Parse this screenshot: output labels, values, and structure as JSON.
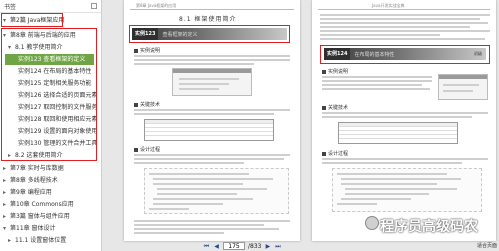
{
  "sidebar": {
    "title": "书签",
    "items": [
      {
        "label": "第2篇 Java框架应用",
        "arrow": "▾"
      },
      {
        "label": "第8章 前端与后端的应用",
        "arrow": "▾"
      },
      {
        "label": "8.1 教学使用简介",
        "arrow": "▾"
      },
      {
        "label": "实例123 查看框架的定义"
      },
      {
        "label": "实例124 在布局的基本特性"
      },
      {
        "label": "实例125 定制相关服务功能"
      },
      {
        "label": "实例126 选择合适的页面元素"
      },
      {
        "label": "实例127 取回控制的文件服务"
      },
      {
        "label": "实例128 取回和使用相应元素"
      },
      {
        "label": "实例129 设置的面向对象使用"
      },
      {
        "label": "实例130 管理的文件合并工具"
      },
      {
        "label": "8.2 这套使用简介",
        "arrow": "▸"
      },
      {
        "label": "第7章 实时与库数据",
        "arrow": "▸"
      },
      {
        "label": "第8章 多线程技术",
        "arrow": "▸"
      },
      {
        "label": "第9章 编程应用",
        "arrow": "▸"
      },
      {
        "label": "第10章 Commons应用",
        "arrow": "▸"
      },
      {
        "label": "第3篇 窗体与组件应用",
        "arrow": "▸"
      },
      {
        "label": "第11章 窗体设计",
        "arrow": "▾"
      },
      {
        "label": "11.1 设置窗体位置",
        "arrow": "▸"
      }
    ]
  },
  "left_page": {
    "header": "第8章 Java框架的应用",
    "chapter_title": "8.1 框架使用简介",
    "banner_tag": "实例123",
    "banner_title": "查看框架的定义",
    "sections": [
      "实例说明",
      "关键技术",
      "设计过程"
    ]
  },
  "right_page": {
    "header": "Java开发实战宝典",
    "banner_tag": "实例124",
    "banner_title": "在布局的基本特性",
    "banner_right": "初级",
    "sections": [
      "实例说明",
      "关键技术",
      "设计过程"
    ]
  },
  "nav": {
    "current_page": "175",
    "total": "/833"
  },
  "corner_label": "适合页面",
  "watermark": "程序员高级码农"
}
